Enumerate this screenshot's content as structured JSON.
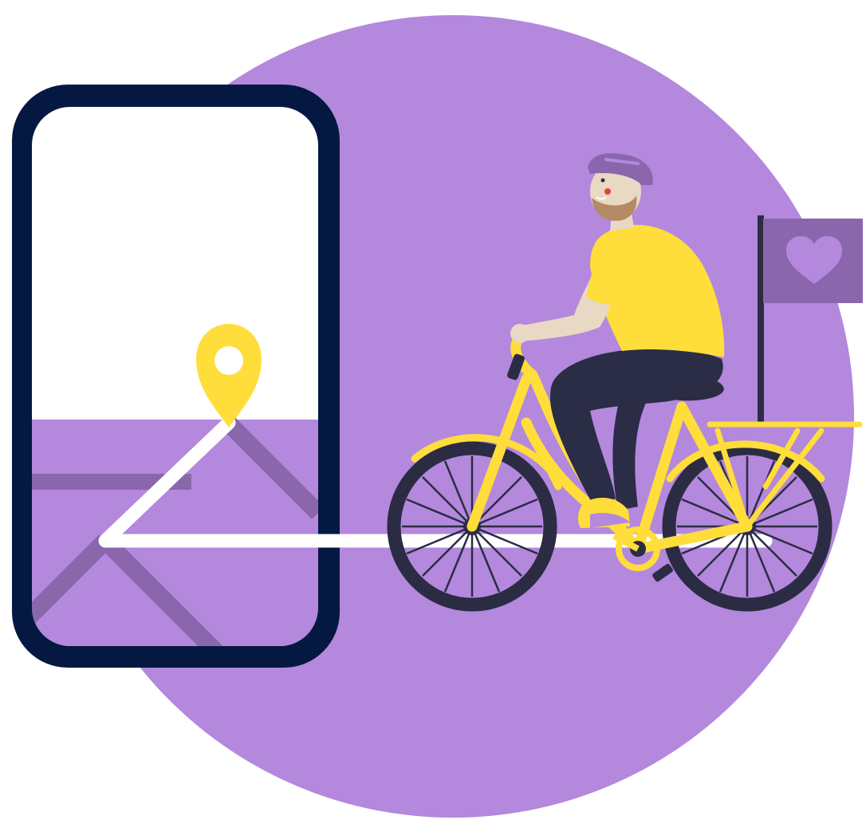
{
  "illustration": {
    "subject": "cyclist-following-map-route",
    "palette": {
      "background": "#ffffff",
      "circle": "#b388dd",
      "circle_dark": "#8a66ad",
      "phone_frame": "#041842",
      "screen_top": "#ffffff",
      "route_line": "#ffffff",
      "pin": "#ffdd3b",
      "bike_frame": "#ffdd3b",
      "wheel": "#2b2c43",
      "shirt": "#ffdd3b",
      "pants": "#2b2c45",
      "skin": "#e9d8c3",
      "helmet": "#8a66ad",
      "beard": "#b48a66",
      "flag": "#8a66ad",
      "heart": "#b388dd"
    },
    "icons": {
      "phone": "smartphone-icon",
      "pin": "location-pin-icon",
      "flag": "heart-flag-icon",
      "bicycle": "bicycle-icon"
    }
  }
}
